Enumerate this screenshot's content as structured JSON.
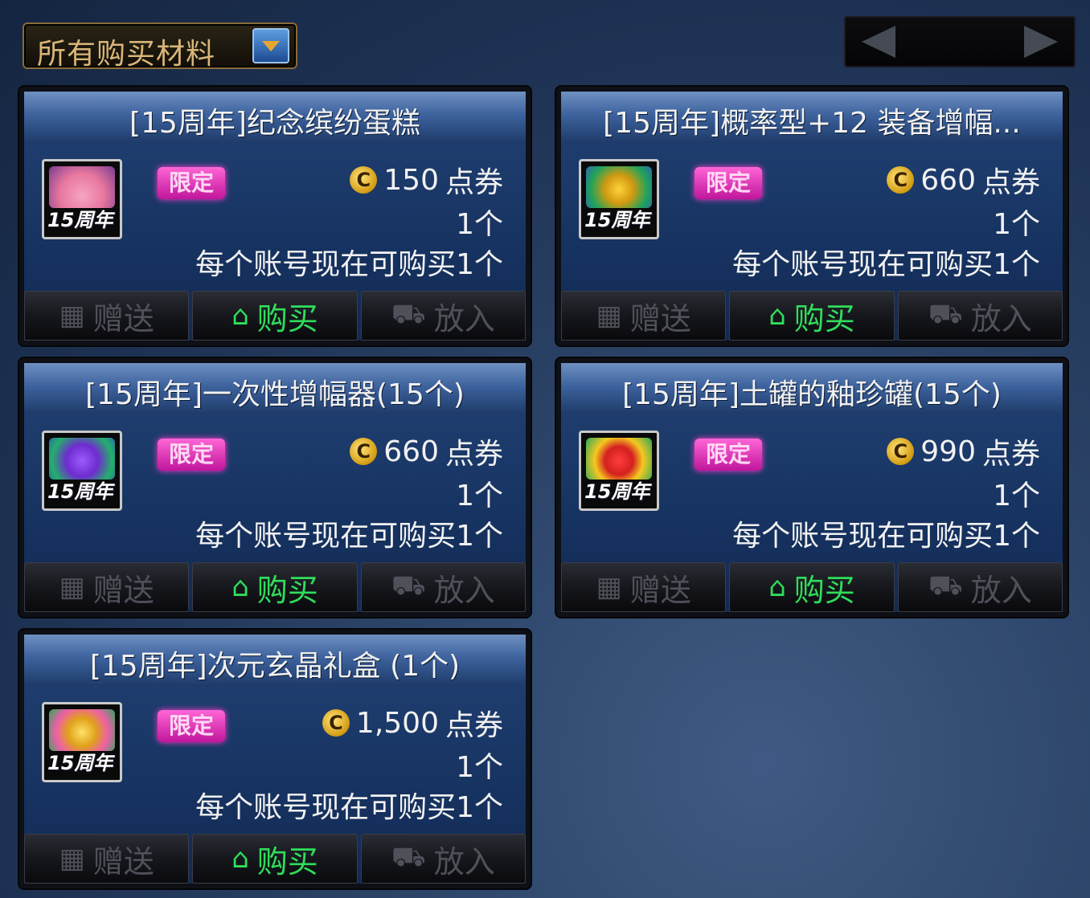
{
  "filter": {
    "label": "所有购买材料"
  },
  "pager": {
    "prev_icon": "left-arrow-icon",
    "next_icon": "right-arrow-icon"
  },
  "common": {
    "limited_badge": "限定",
    "icon_tag": "15周年",
    "gift_label": "赠送",
    "buy_label": "购买",
    "cart_label": "放入",
    "quantity": "1个",
    "limit_text": "每个账号现在可购买1个",
    "currency_unit": "点券"
  },
  "items": [
    {
      "title": "[15周年]纪念缤纷蛋糕",
      "price": "150",
      "icon": "cake-icon"
    },
    {
      "title": "[15周年]概率型+12 装备增幅...",
      "price": "660",
      "icon": "gift-box-icon"
    },
    {
      "title": "[15周年]一次性增幅器(15个)",
      "price": "660",
      "icon": "gift-box-icon"
    },
    {
      "title": "[15周年]土罐的釉珍罐(15个)",
      "price": "990",
      "icon": "gift-box-icon"
    },
    {
      "title": "[15周年]次元玄晶礼盒 (1个)",
      "price": "1,500",
      "icon": "gift-box-icon"
    }
  ],
  "colors": {
    "buy_green": "#2fdd5b",
    "title_bar": "#3d629d",
    "limited_pink": "#ff66d6"
  }
}
